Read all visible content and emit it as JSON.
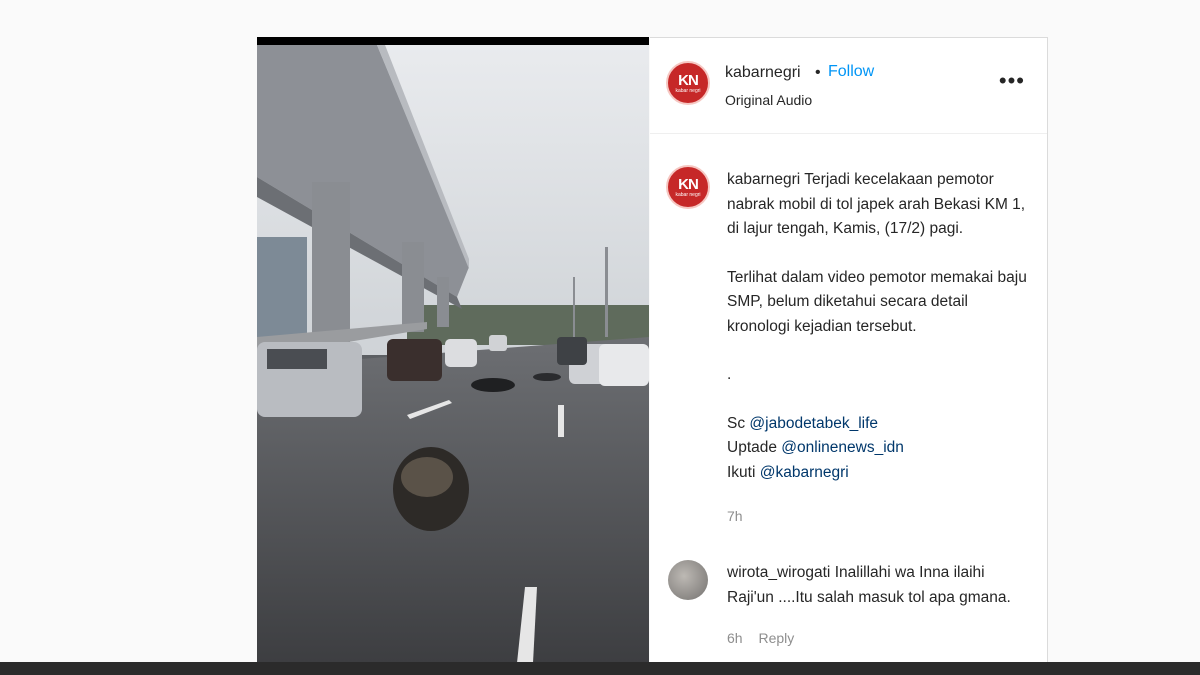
{
  "post": {
    "username": "kabarnegri",
    "separator": "•",
    "follow_label": "Follow",
    "audio_label": "Original Audio",
    "more_icon": "•••",
    "logo_text": "KN",
    "logo_subtext": "kabar negri",
    "caption_p1": "Terjadi kecelakaan pemotor nabrak mobil di tol japek arah Bekasi KM 1, di lajur tengah, Kamis, (17/2) pagi.",
    "caption_p2": "Terlihat dalam video pemotor memakai baju SMP, belum diketahui secara detail kronologi kejadian tersebut.",
    "caption_dot": ".",
    "credit1_prefix": "Sc",
    "credit1_mention": "@jabodetabek_life",
    "credit2_prefix": "Uptade",
    "credit2_mention": "@onlinenews_idn",
    "credit3_prefix": "Ikuti",
    "credit3_mention": "@kabarnegri",
    "time": "7h"
  },
  "comment": {
    "username": "wirota_wirogati",
    "text": "Inalillahi wa Inna ilaihi Raji'un ....Itu salah masuk tol apa gmana.",
    "time": "6h",
    "reply_label": "Reply"
  },
  "colors": {
    "follow": "#0095f6",
    "mention": "#00376b",
    "brand": "#c62828"
  }
}
